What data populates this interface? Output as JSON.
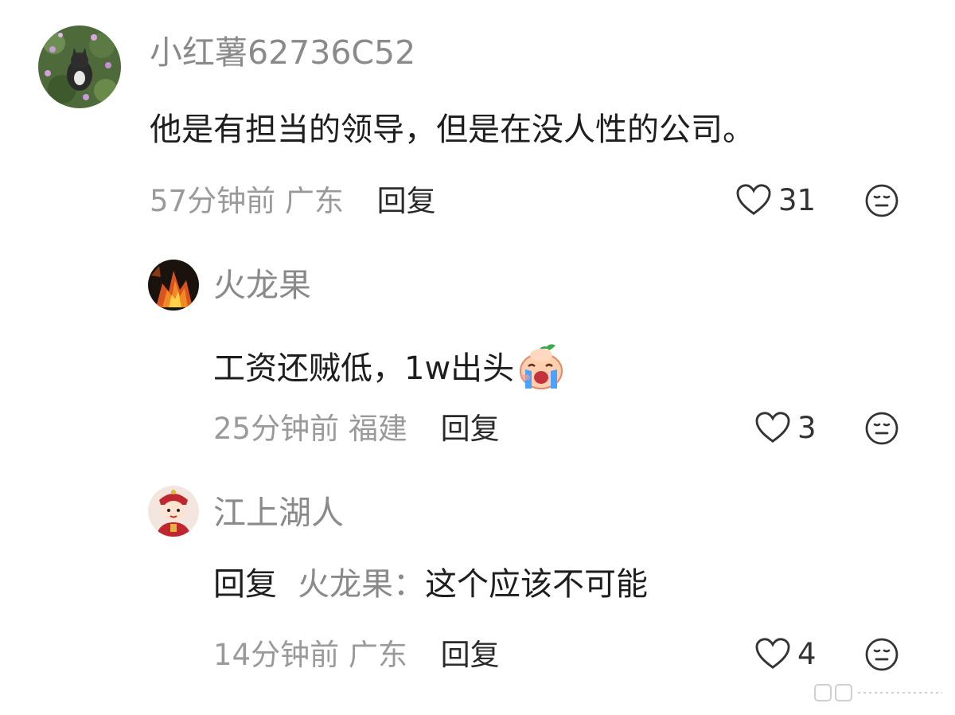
{
  "comments": [
    {
      "username": "小红薯62736C52",
      "text": "他是有担当的领导，但是在没人性的公司。",
      "time": "57分钟前",
      "location": "广东",
      "reply_label": "回复",
      "likes": "31"
    },
    {
      "username": "火龙果",
      "text": "工资还贼低，1w出头",
      "emoji": "crying-face-emoji",
      "time": "25分钟前",
      "location": "福建",
      "reply_label": "回复",
      "likes": "3"
    },
    {
      "username": "江上湖人",
      "reply_prefix": "回复",
      "reply_target": "火龙果：",
      "text": "这个应该不可能",
      "time": "14分钟前",
      "location": "广东",
      "reply_label": "回复",
      "likes": "4"
    }
  ],
  "icons": {
    "like": "heart-outline-icon",
    "dislike": "neutral-face-icon"
  },
  "colors": {
    "username": "#8a8a8a",
    "text": "#1e1e1e",
    "meta": "#9a9a9a"
  }
}
